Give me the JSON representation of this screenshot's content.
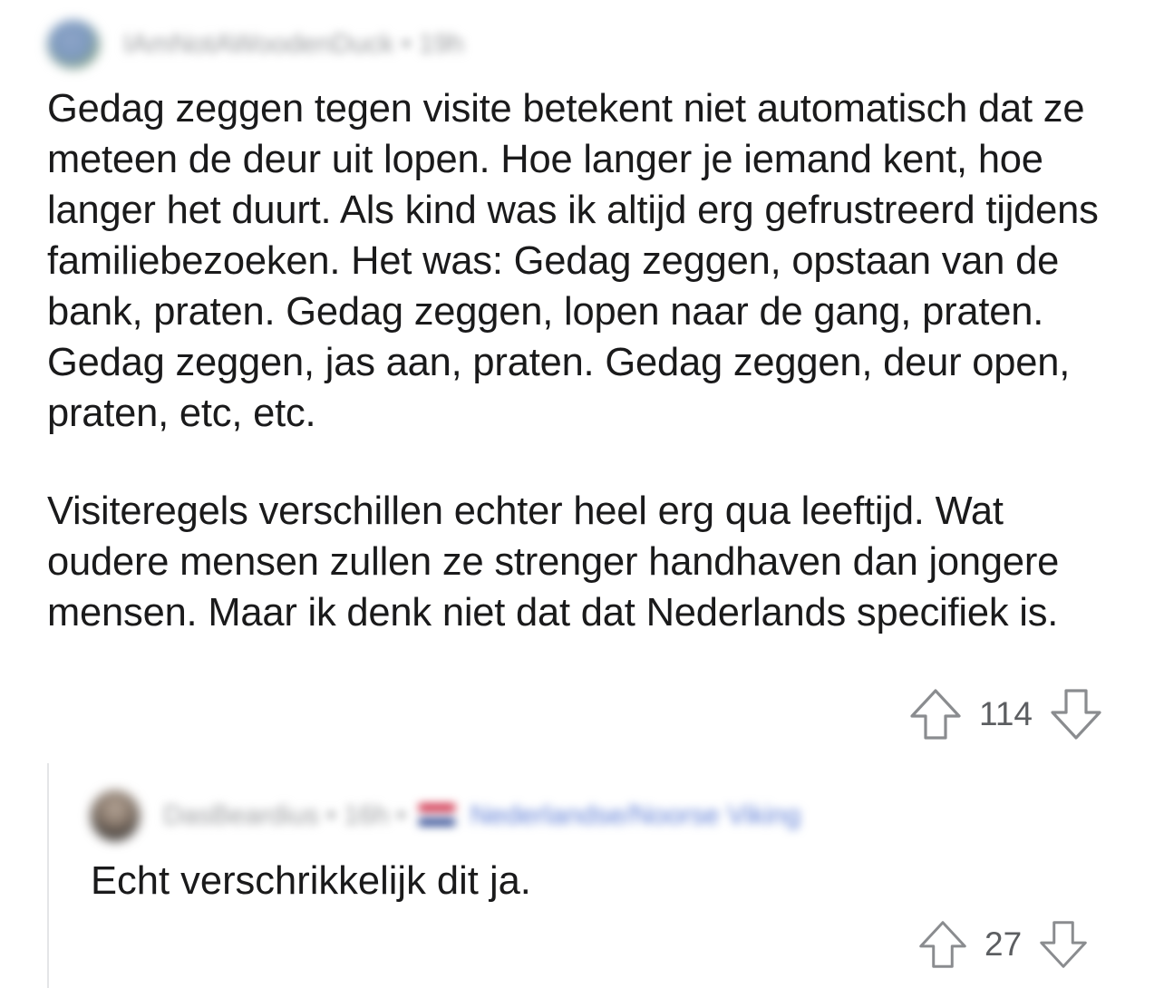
{
  "comment": {
    "author": "IAmNotAWoodenDuck",
    "separator": "•",
    "age": "19h",
    "paragraphs": [
      "Gedag zeggen tegen visite betekent niet automatisch dat ze meteen de deur uit lopen. Hoe langer je iemand kent, hoe langer het duurt. Als kind was ik altijd erg gefrustreerd tijdens familiebezoeken. Het was: Gedag zeggen, opstaan van de bank, praten. Gedag zeggen, lopen naar de gang, praten. Gedag zeggen, jas aan, praten. Gedag zeggen, deur open, praten, etc, etc.",
      "Visiteregels verschillen echter heel erg qua leeftijd. Wat oudere mensen zullen ze strenger handhaven dan jongere mensen. Maar ik denk niet dat dat Nederlands specifiek is."
    ],
    "upvote_icon": "arrow-up-icon",
    "downvote_icon": "arrow-down-icon",
    "score": "114"
  },
  "reply": {
    "author": "DasBeardius",
    "separator": "•",
    "age": "16h",
    "flair": "Nederlandse/Noorse Viking",
    "text": "Echt verschrikkelijk dit ja.",
    "upvote_icon": "arrow-up-icon",
    "downvote_icon": "arrow-down-icon",
    "score": "27"
  },
  "colors": {
    "text": "#1a1a1b",
    "meta": "#9a9c9f",
    "vote": "#5c5e61",
    "thread_line": "#e4e5e7",
    "flair": "#5f7fd6"
  }
}
